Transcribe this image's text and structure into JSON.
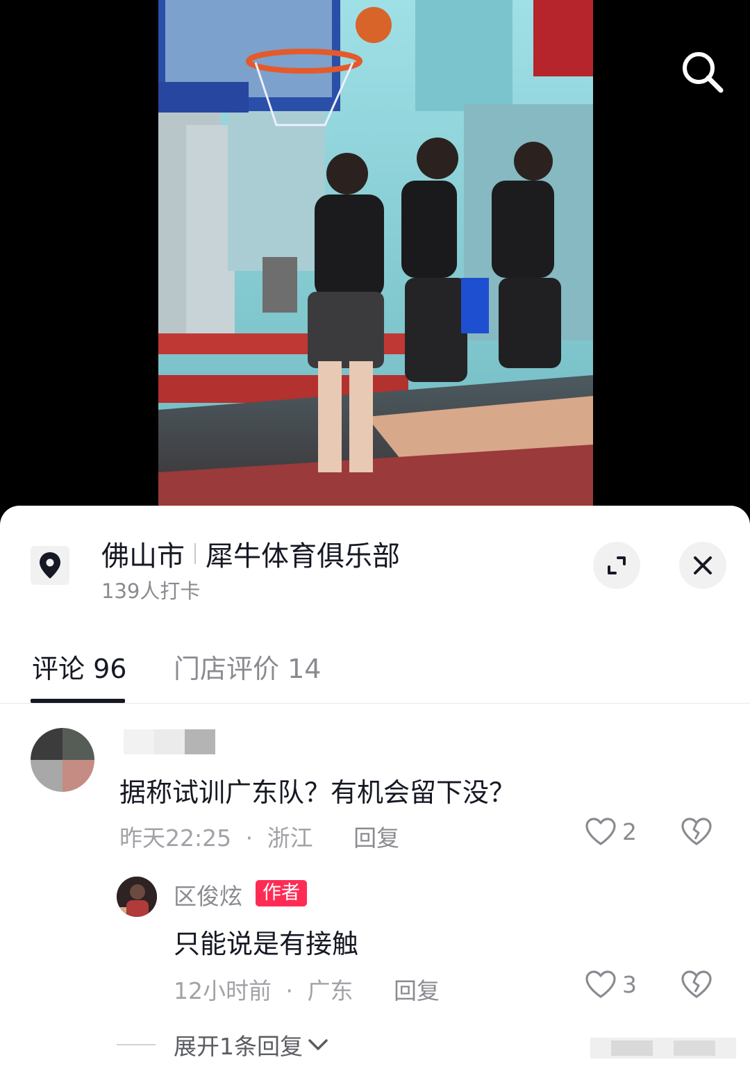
{
  "video": {
    "search_icon": "search-icon"
  },
  "location": {
    "city": "佛山市",
    "place": "犀牛体育俱乐部",
    "checkins": "139人打卡",
    "icon": "location-pin-icon"
  },
  "tabs": [
    {
      "label": "评论 96",
      "active": true
    },
    {
      "label": "门店评价 14",
      "active": false
    }
  ],
  "comments": [
    {
      "text": "据称试训广东队？有机会留下没？",
      "time": "昨天22:25",
      "region": "浙江",
      "reply_label": "回复",
      "likes": "2"
    }
  ],
  "replies": [
    {
      "author": "区俊炫",
      "badge": "作者",
      "text": "只能说是有接触",
      "time": "12小时前",
      "region": "广东",
      "reply_label": "回复",
      "likes": "3"
    }
  ],
  "expand_replies": "展开1条回复",
  "colors": {
    "accent": "#fe2c55",
    "text_primary": "#161823",
    "text_secondary": "#8a8b91"
  }
}
